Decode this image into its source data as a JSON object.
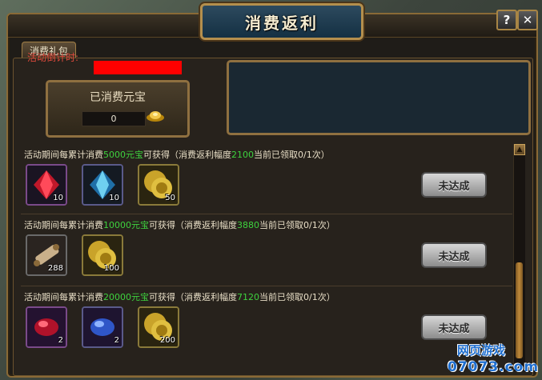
{
  "window": {
    "title": "消费返利",
    "help_label": "?",
    "close_label": "✕"
  },
  "tabs": [
    {
      "label": "消费礼包"
    }
  ],
  "countdown": {
    "label": "活动倒计时:"
  },
  "consumed": {
    "label": "已消费元宝",
    "value": "0"
  },
  "rows": [
    {
      "prefix": "活动期间每累计消费",
      "amount": "5000元宝",
      "middle": "可获得（消费返利幅度",
      "rebate": "2100",
      "suffix": "当前已领取0/1次）",
      "items": [
        {
          "icon": "red-gem-icon",
          "qty": "10"
        },
        {
          "icon": "blue-gem-icon",
          "qty": "10"
        },
        {
          "icon": "gold-coin-pile-icon",
          "qty": "50"
        }
      ],
      "button": "未达成"
    },
    {
      "prefix": "活动期间每累计消费",
      "amount": "10000元宝",
      "middle": "可获得（消费返利幅度",
      "rebate": "3880",
      "suffix": "当前已领取0/1次）",
      "items": [
        {
          "icon": "scroll-icon",
          "qty": "288"
        },
        {
          "icon": "gold-coin-pile-icon",
          "qty": "100"
        }
      ],
      "button": "未达成"
    },
    {
      "prefix": "活动期间每累计消费",
      "amount": "20000元宝",
      "middle": "可获得（消费返利幅度",
      "rebate": "7120",
      "suffix": "当前已领取0/1次）",
      "items": [
        {
          "icon": "red-oval-gem-icon",
          "qty": "2"
        },
        {
          "icon": "blue-oval-gem-icon",
          "qty": "2"
        },
        {
          "icon": "gold-coin-pile-icon",
          "qty": "200"
        }
      ],
      "button": "未达成"
    }
  ],
  "watermark": {
    "line1": "网页游戏",
    "line2": "07073.com"
  },
  "colors": {
    "highlight": "#3ed23e",
    "countdown": "#e04a3c",
    "frame": "#8f7040"
  }
}
